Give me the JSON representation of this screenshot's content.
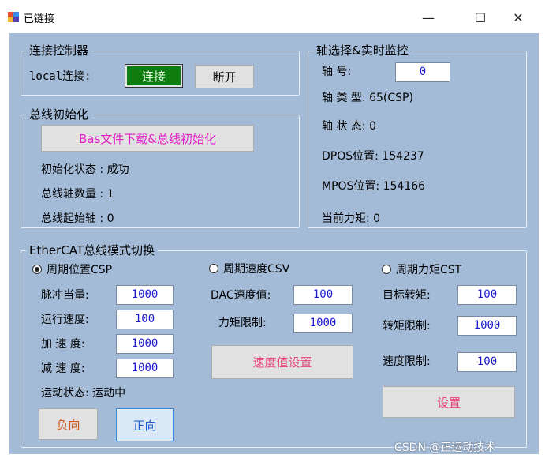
{
  "window": {
    "title": "已链接",
    "minimize": "—",
    "maximize": "☐",
    "close": "✕"
  },
  "connect_group": {
    "title": "连接控制器",
    "local_label": "local连接:",
    "connect_button": "连接",
    "disconnect_button": "断开"
  },
  "bus_init_group": {
    "title": "总线初始化",
    "init_button": "Bas文件下载&总线初始化",
    "init_status": "初始化状态 : 成功",
    "axis_count": "总线轴数量 : 1",
    "start_axis": "总线起始轴 : 0"
  },
  "monitor_group": {
    "title": "轴选择&实时监控",
    "axis_no_label": "轴    号:",
    "axis_no_value": "0",
    "axis_type": "轴 类 型: 65(CSP)",
    "axis_status": "轴 状 态: 0",
    "dpos": "DPOS位置: 154237",
    "mpos": "MPOS位置: 154166",
    "torque": "当前力矩: 0"
  },
  "mode_group": {
    "title": "EtherCAT总线模式切换",
    "csp": {
      "radio": "周期位置CSP",
      "selected": true,
      "pulse_label": "脉冲当量:",
      "pulse_value": "1000",
      "speed_label": "运行速度:",
      "speed_value": "100",
      "accel_label": "加 速 度:",
      "accel_value": "1000",
      "decel_label": "减 速 度:",
      "decel_value": "1000",
      "motion_status": "运动状态:  运动中",
      "neg_button": "负向",
      "pos_button": "正向"
    },
    "csv": {
      "radio": "周期速度CSV",
      "selected": false,
      "dac_label": "DAC速度值:",
      "dac_value": "100",
      "torque_limit_label": "力矩限制:",
      "torque_limit_value": "1000",
      "set_button": "速度值设置"
    },
    "cst": {
      "radio": "周期力矩CST",
      "selected": false,
      "target_torque_label": "目标转矩:",
      "target_torque_value": "100",
      "torque_limit_label": "转矩限制:",
      "torque_limit_value": "1000",
      "speed_limit_label": "速度限制:",
      "speed_limit_value": "100",
      "set_button": "设置"
    }
  },
  "watermark": "CSDN @正运动技术"
}
